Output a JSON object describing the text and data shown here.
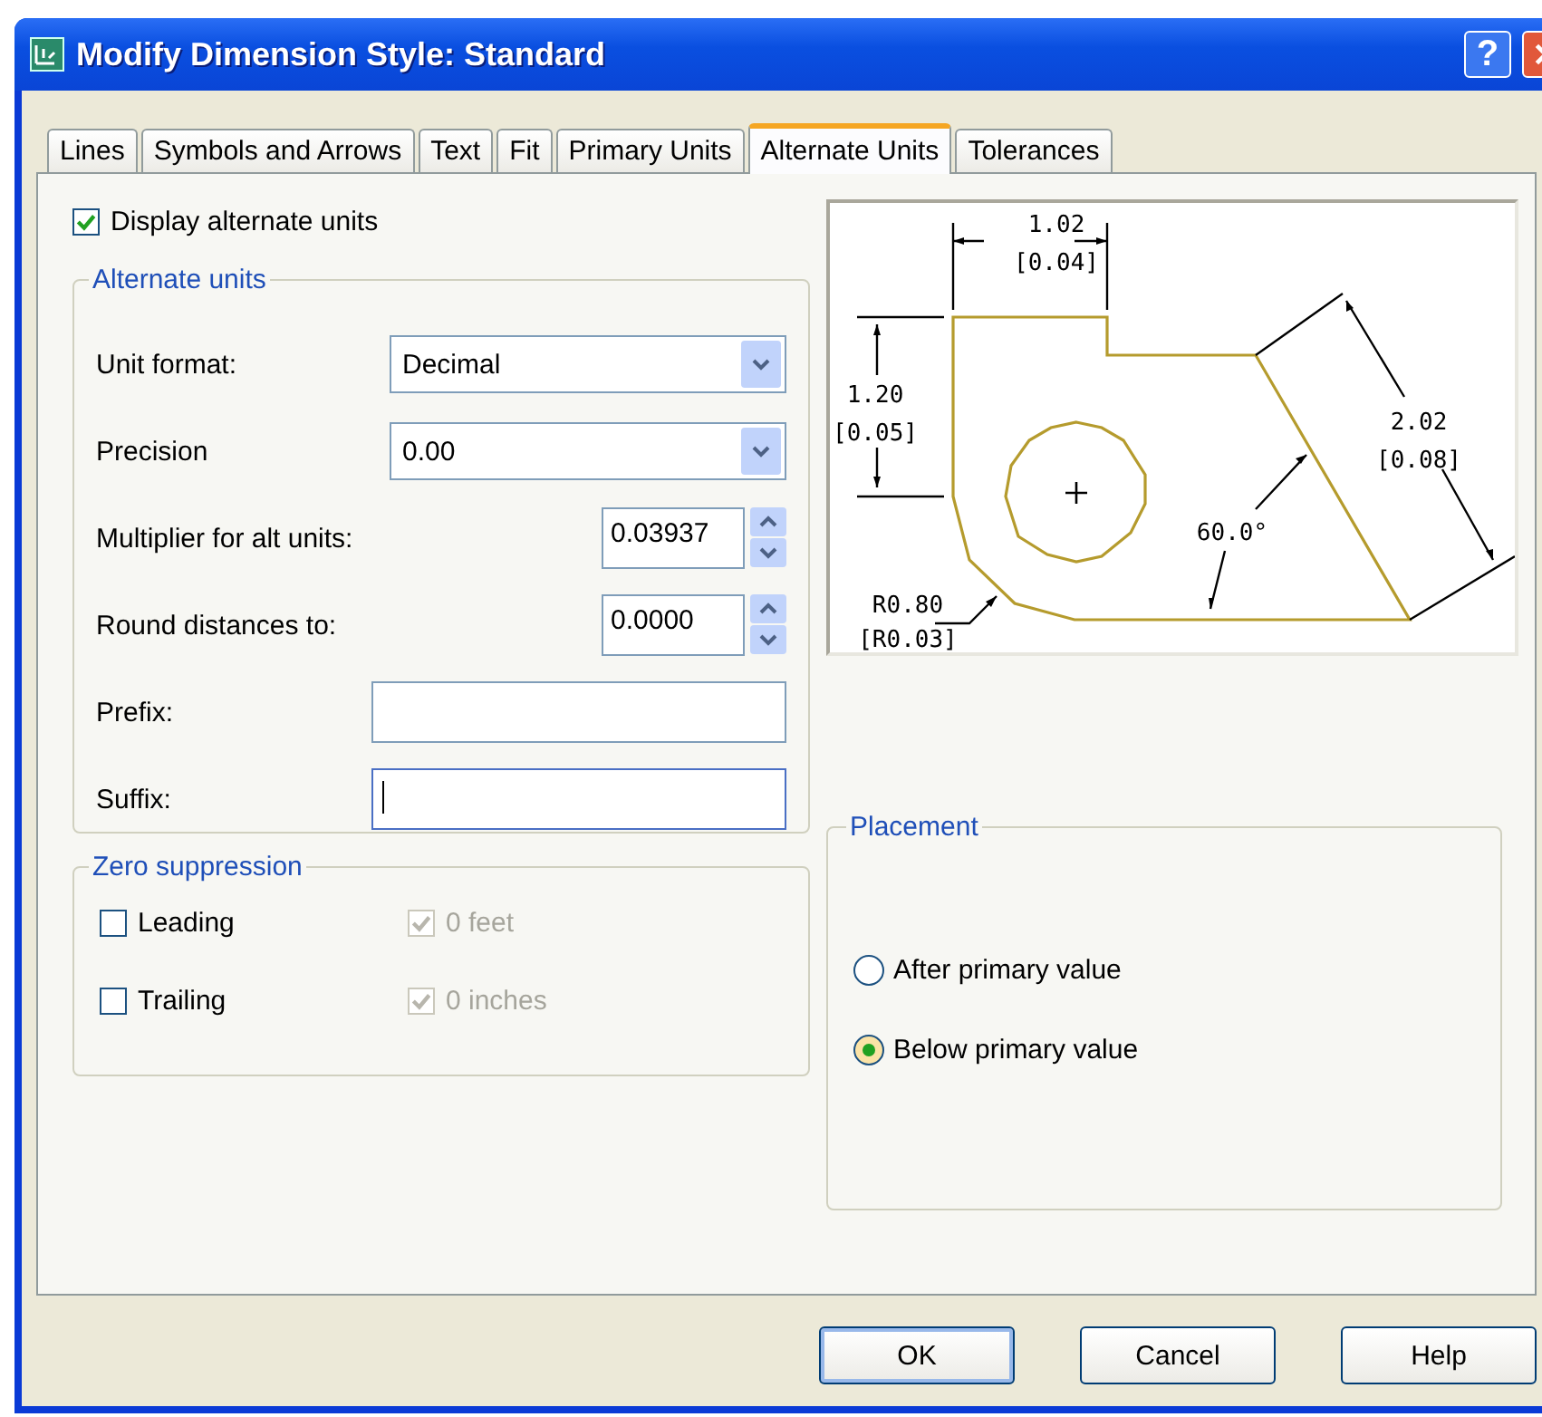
{
  "window": {
    "title": "Modify Dimension Style: Standard",
    "help_glyph": "?"
  },
  "tabs": [
    {
      "label": "Lines",
      "selected": false
    },
    {
      "label": "Symbols and Arrows",
      "selected": false
    },
    {
      "label": "Text",
      "selected": false
    },
    {
      "label": "Fit",
      "selected": false
    },
    {
      "label": "Primary Units",
      "selected": false
    },
    {
      "label": "Alternate Units",
      "selected": true
    },
    {
      "label": "Tolerances",
      "selected": false
    }
  ],
  "display_alternate_units": {
    "label": "Display alternate units",
    "checked": true
  },
  "alternate_units": {
    "title": "Alternate units",
    "fields": [
      {
        "kind": "dropdown",
        "label": "Unit format:",
        "value": "Decimal"
      },
      {
        "kind": "dropdown",
        "label": "Precision",
        "value": "0.00"
      },
      {
        "kind": "spinner",
        "label": "Multiplier for alt units:",
        "value": "0.03937"
      },
      {
        "kind": "spinner",
        "label": "Round distances  to:",
        "value": "0.0000"
      },
      {
        "kind": "text",
        "label": "Prefix:",
        "focused": false
      },
      {
        "kind": "text",
        "label": "Suffix:",
        "focused": true
      }
    ]
  },
  "zero_suppression": {
    "title": "Zero suppression",
    "options": [
      {
        "label": "Leading",
        "checked": false,
        "disabled": false
      },
      {
        "label": "0 feet",
        "checked": true,
        "disabled": true
      },
      {
        "label": "Trailing",
        "checked": false,
        "disabled": false
      },
      {
        "label": "0 inches",
        "checked": true,
        "disabled": true
      }
    ]
  },
  "preview": {
    "labels": [
      "1.02",
      "[0.04]",
      "1.20",
      "[0.05]",
      "2.02",
      "[0.08]",
      "60.0°",
      "R0.80",
      "[R0.03]"
    ]
  },
  "placement": {
    "title": "Placement",
    "options": [
      {
        "label": "After primary value",
        "selected": false
      },
      {
        "label": "Below primary value",
        "selected": true
      }
    ]
  },
  "buttons": [
    {
      "label": "OK",
      "default": true
    },
    {
      "label": "Cancel",
      "default": false
    },
    {
      "label": "Help",
      "default": false
    }
  ]
}
